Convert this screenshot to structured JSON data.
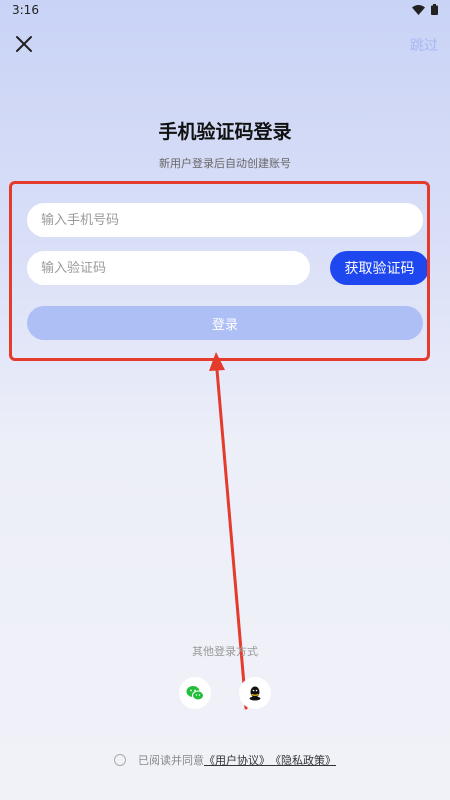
{
  "status_bar": {
    "time": "3:16",
    "wifi_icon": "wifi-icon",
    "battery_icon": "battery-icon"
  },
  "header": {
    "close_icon": "close-icon",
    "skip_label": "跳过"
  },
  "title": "手机验证码登录",
  "subtitle": "新用户登录后自动创建账号",
  "form": {
    "phone_placeholder": "输入手机号码",
    "phone_value": "",
    "code_placeholder": "输入验证码",
    "code_value": "",
    "get_code_label": "获取验证码",
    "login_label": "登录"
  },
  "other_login": {
    "label": "其他登录方式",
    "methods": [
      {
        "name": "wechat-icon",
        "color": "#22c03a"
      },
      {
        "name": "qq-icon",
        "color": "#111111"
      }
    ]
  },
  "agreement": {
    "prefix": "已阅读并同意",
    "user_agreement": "《用户协议》",
    "privacy_policy": "《隐私政策》"
  },
  "colors": {
    "primary": "#1f47f0",
    "login_disabled": "#adbff5",
    "annotation_red": "#e53b2c"
  }
}
